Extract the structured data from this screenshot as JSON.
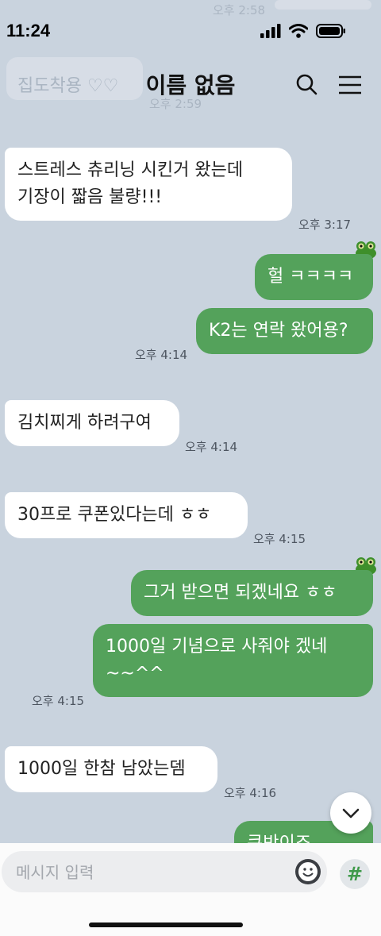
{
  "status": {
    "time": "11:24"
  },
  "ghost": {
    "time_top": "오후 2:58",
    "preview_text": "집도착용 ♡♡",
    "time_second": "오후 2:59"
  },
  "header": {
    "title": "이름 없음",
    "search_icon": "search-icon",
    "menu_icon": "hamburger-menu-icon"
  },
  "messages": [
    {
      "side": "in",
      "text": "스트레스 츄리닝 시킨거 왔는데\n기장이 짧음 불량!!!",
      "time": "오후 3:17"
    },
    {
      "side": "out",
      "text": "헐 ㅋㅋㅋㅋ"
    },
    {
      "side": "out",
      "text": "K2는 연락 왔어용?",
      "time": "오후 4:14"
    },
    {
      "side": "in",
      "text": "김치찌게 하려구여",
      "time": "오후 4:14"
    },
    {
      "side": "in",
      "text": "30프로 쿠폰있다는데 ㅎㅎ",
      "time": "오후 4:15"
    },
    {
      "side": "out",
      "text": "그거 받으면 되겠네요 ㅎㅎ"
    },
    {
      "side": "out",
      "text": "1000일 기념으로 사줘야 겠네\n~~^^",
      "time": "오후 4:15"
    },
    {
      "side": "in",
      "text": "1000일 한참 남았는뎀",
      "time": "오후 4:16"
    },
    {
      "side": "out",
      "text": "쿠반이죠@@^^"
    }
  ],
  "input": {
    "placeholder": "메시지 입력",
    "emoji_icon": "emoji-icon",
    "hash_label": "#"
  },
  "colors": {
    "background": "#c9d3de",
    "outgoing_bubble": "#54a25b",
    "incoming_bubble": "#ffffff",
    "hash_green": "#3f9a4a"
  }
}
